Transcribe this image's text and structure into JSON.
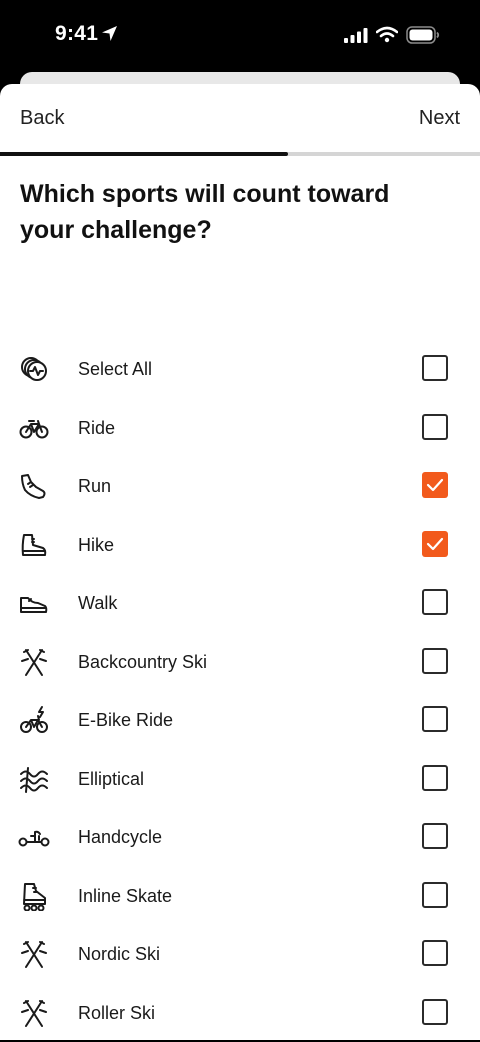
{
  "status_bar": {
    "time": "9:41"
  },
  "nav": {
    "back_label": "Back",
    "next_label": "Next"
  },
  "progress": {
    "fraction": 0.6
  },
  "question": "Which sports will count toward your challenge?",
  "accent_color": "#f25a1c",
  "sports": [
    {
      "label": "Select All",
      "icon": "activities-icon",
      "checked": false
    },
    {
      "label": "Ride",
      "icon": "bike-icon",
      "checked": false
    },
    {
      "label": "Run",
      "icon": "running-shoe-icon",
      "checked": true
    },
    {
      "label": "Hike",
      "icon": "hiking-boot-icon",
      "checked": true
    },
    {
      "label": "Walk",
      "icon": "walking-shoe-icon",
      "checked": false
    },
    {
      "label": "Backcountry Ski",
      "icon": "crossed-skis-icon",
      "checked": false
    },
    {
      "label": "E-Bike Ride",
      "icon": "ebike-icon",
      "checked": false
    },
    {
      "label": "Elliptical",
      "icon": "elliptical-icon",
      "checked": false
    },
    {
      "label": "Handcycle",
      "icon": "handcycle-icon",
      "checked": false
    },
    {
      "label": "Inline Skate",
      "icon": "inline-skate-icon",
      "checked": false
    },
    {
      "label": "Nordic Ski",
      "icon": "crossed-skis-icon",
      "checked": false
    },
    {
      "label": "Roller Ski",
      "icon": "crossed-skis-icon",
      "checked": false
    }
  ]
}
